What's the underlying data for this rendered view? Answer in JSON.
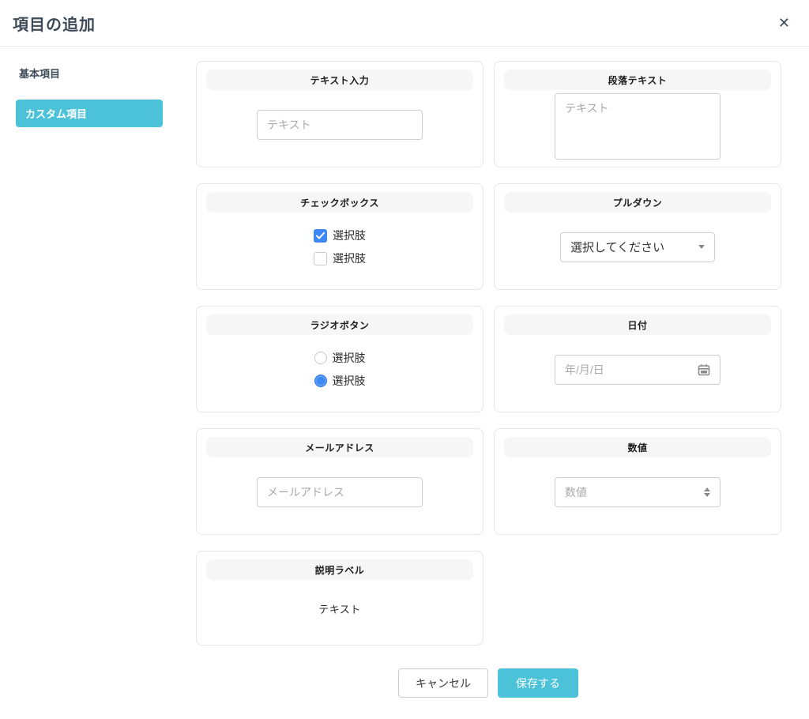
{
  "modal": {
    "title": "項目の追加",
    "close_icon": "✕"
  },
  "sidebar": {
    "items": [
      {
        "label": "基本項目",
        "active": false
      },
      {
        "label": "カスタム項目",
        "active": true
      }
    ]
  },
  "cards": {
    "text_input": {
      "title": "テキスト入力",
      "placeholder": "テキスト"
    },
    "paragraph_text": {
      "title": "段落テキスト",
      "placeholder": "テキスト"
    },
    "checkbox": {
      "title": "チェックボックス",
      "options": [
        {
          "label": "選択肢",
          "checked": true
        },
        {
          "label": "選択肢",
          "checked": false
        }
      ]
    },
    "pulldown": {
      "title": "プルダウン",
      "selected_value": "選択してください"
    },
    "radio": {
      "title": "ラジオボタン",
      "options": [
        {
          "label": "選択肢",
          "checked": false
        },
        {
          "label": "選択肢",
          "checked": true
        }
      ]
    },
    "date": {
      "title": "日付",
      "placeholder": "年/月/日"
    },
    "email": {
      "title": "メールアドレス",
      "placeholder": "メールアドレス"
    },
    "number": {
      "title": "数値",
      "placeholder": "数値"
    },
    "description_label": {
      "title": "説明ラベル",
      "text": "テキスト"
    }
  },
  "footer": {
    "cancel_label": "キャンセル",
    "save_label": "保存する"
  },
  "colors": {
    "accent_cyan": "#4cc2d9",
    "selection_blue": "#3d87f6",
    "title_dark": "#3d4a57"
  }
}
